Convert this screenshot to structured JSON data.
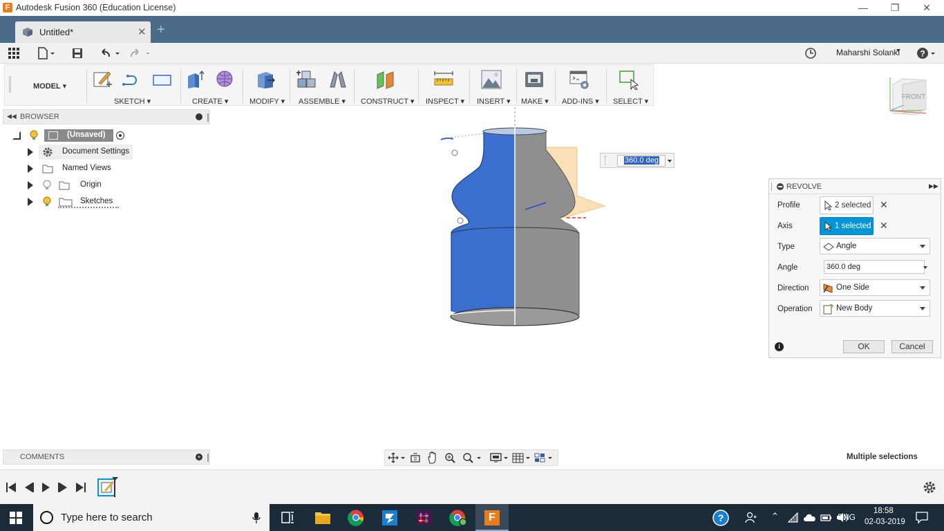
{
  "window": {
    "title": "Autodesk Fusion 360 (Education License)"
  },
  "tabs": {
    "doc_title": "Untitled*"
  },
  "quick_access": {
    "user": "Maharshi Solanki"
  },
  "toolbar": {
    "workspace": "MODEL",
    "groups": [
      "SKETCH",
      "CREATE",
      "MODIFY",
      "ASSEMBLE",
      "CONSTRUCT",
      "INSPECT",
      "INSERT",
      "MAKE",
      "ADD-INS",
      "SELECT"
    ]
  },
  "browser": {
    "title": "BROWSER",
    "root": "(Unsaved)",
    "items": [
      "Document Settings",
      "Named Views",
      "Origin",
      "Sketches"
    ]
  },
  "viewport": {
    "angle_input": "360.0 deg",
    "viewcube_face": "FRONT"
  },
  "revolve": {
    "title": "REVOLVE",
    "profile_label": "Profile",
    "profile_value": "2 selected",
    "axis_label": "Axis",
    "axis_value": "1 selected",
    "type_label": "Type",
    "type_value": "Angle",
    "angle_label": "Angle",
    "angle_value": "360.0 deg",
    "direction_label": "Direction",
    "direction_value": "One Side",
    "operation_label": "Operation",
    "operation_value": "New Body",
    "ok": "OK",
    "cancel": "Cancel"
  },
  "comments": {
    "title": "COMMENTS"
  },
  "status": {
    "text": "Multiple selections"
  },
  "taskbar": {
    "search_placeholder": "Type here to search",
    "lang": "ENG",
    "time": "18:58",
    "date": "02-03-2019"
  },
  "colors": {
    "tab_bar": "#4a6b8a",
    "accent_blue": "#0696d7",
    "body_blue": "#3a6fd0",
    "taskbar": "#1c2b3a"
  }
}
